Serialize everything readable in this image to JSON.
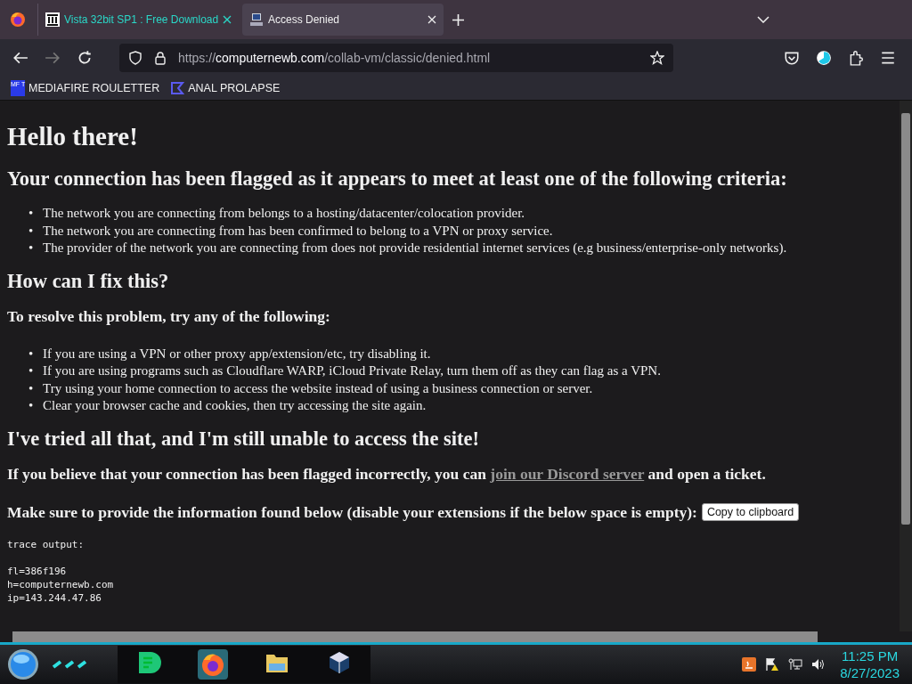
{
  "tabs": [
    {
      "label": "Vista 32bit SP1 : Free Download",
      "selected": false
    },
    {
      "label": "Access Denied",
      "selected": true
    }
  ],
  "address": {
    "scheme": "https://",
    "host": "computernewb.com",
    "path": "/collab-vm/classic/denied.html"
  },
  "bookmarks": [
    {
      "label": "MEDIAFIRE ROULETTER",
      "icon_text": "MF T"
    },
    {
      "label": "ANAL PROLAPSE"
    }
  ],
  "page": {
    "title": "Hello there!",
    "bullet": "•",
    "heading_1": "Your connection has been flagged as it appears to meet at least one of the following criteria:",
    "criteria": [
      "The network you are connecting from belongs to a hosting/datacenter/colocation provider.",
      "The network you are connecting from has been confirmed to belong to a VPN or proxy service.",
      "The provider of the network you are connecting from does not provide residential internet services (e.g business/enterprise-only networks)."
    ],
    "heading_2": "How can I fix this?",
    "resolve_intro": "To resolve this problem, try any of the following:",
    "fixes": [
      "If you are using a VPN or other proxy app/extension/etc, try disabling it.",
      "If you are using programs such as Cloudflare WARP, iCloud Private Relay, turn them off as they can flag as a VPN.",
      "Try using your home connection to access the website instead of using a business connection or server.",
      "Clear your browser cache and cookies, then try accessing the site again."
    ],
    "heading_3": "I've tried all that, and I'm still unable to access the site!",
    "discord_before": "If you believe that your connection has been flagged incorrectly, you can ",
    "discord_link": "join our Discord server",
    "discord_after": " and open a ticket.",
    "info_text": "Make sure to provide the information found below (disable your extensions if the below space is empty):",
    "copy_button": "Copy to clipboard",
    "trace_title": "trace output:",
    "trace_lines": [
      "fl=386f196",
      "h=computernewb.com",
      "ip=143.244.47.86"
    ]
  },
  "taskbar": {
    "time": "11:25 PM",
    "date": "8/27/2023"
  }
}
